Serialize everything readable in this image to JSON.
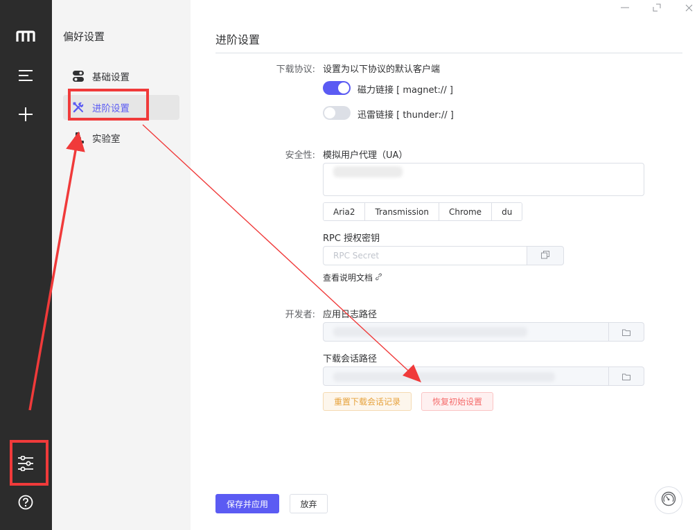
{
  "sidebar": {
    "icons": [
      "logo-icon",
      "task-list-icon",
      "add-icon",
      "settings-sliders-icon",
      "help-icon"
    ]
  },
  "subnav": {
    "title": "偏好设置",
    "items": [
      {
        "label": "基础设置",
        "icon": "toggle-icon"
      },
      {
        "label": "进阶设置",
        "icon": "tools-icon"
      },
      {
        "label": "实验室",
        "icon": "lab-icon"
      }
    ],
    "active_index": 1
  },
  "main": {
    "title": "进阶设置",
    "protocol": {
      "label": "下载协议:",
      "desc": "设置为以下协议的默认客户端",
      "magnet": {
        "label": "磁力链接 [ magnet:// ]",
        "enabled": true
      },
      "thunder": {
        "label": "迅雷链接 [ thunder:// ]",
        "enabled": false
      }
    },
    "security": {
      "label": "安全性:",
      "ua_label": "模拟用户代理（UA）",
      "ua_presets": [
        "Aria2",
        "Transmission",
        "Chrome",
        "du"
      ],
      "rpc_label": "RPC 授权密钥",
      "rpc_placeholder": "RPC Secret",
      "doc_link": "查看说明文档"
    },
    "developer": {
      "label": "开发者:",
      "log_path_label": "应用日志路径",
      "session_path_label": "下载会话路径",
      "reset_session_button": "重置下载会话记录",
      "factory_reset_button": "恢复初始设置"
    },
    "footer": {
      "save_button": "保存并应用",
      "discard_button": "放弃"
    }
  },
  "colors": {
    "accent": "#5b5bf3",
    "rail_bg": "#2c2c2c",
    "subnav_bg": "#f4f4f4",
    "annotation_red": "#f03a3a",
    "warning": "#e6a23c",
    "danger": "#f56c6c"
  }
}
